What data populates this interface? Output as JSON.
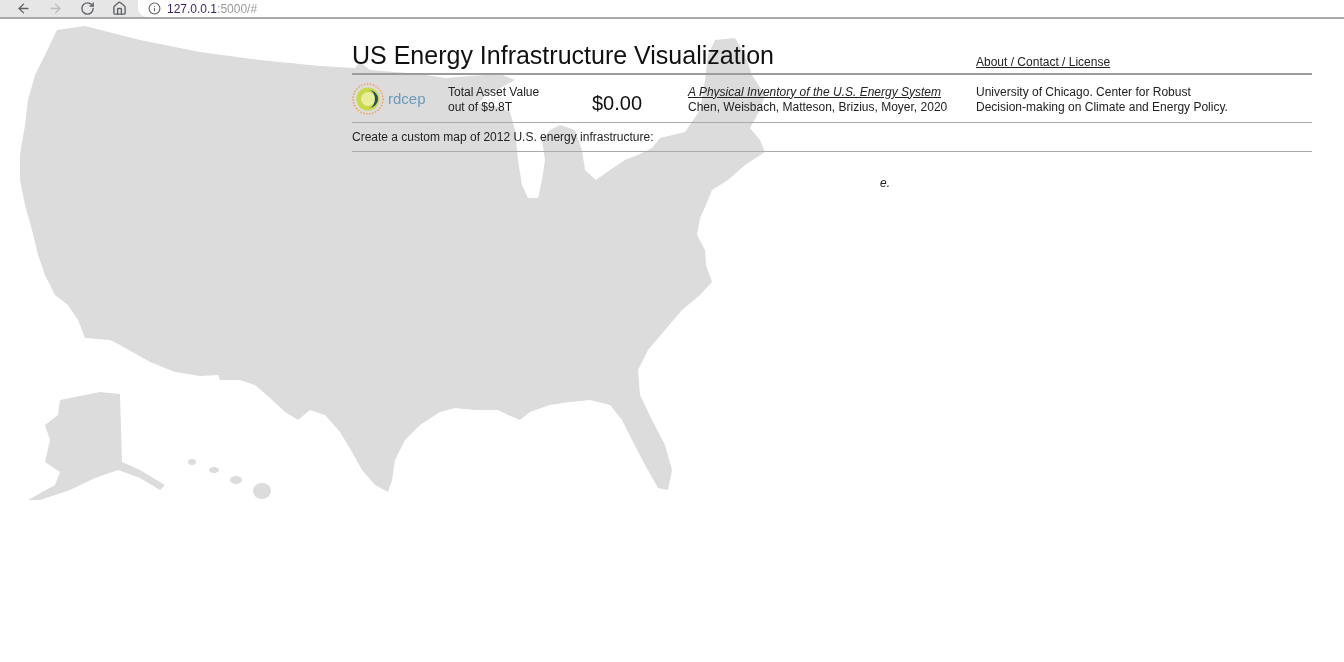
{
  "browser": {
    "nav_buttons": [
      {
        "kind": "back",
        "disabled": false
      },
      {
        "kind": "forward",
        "disabled": true
      },
      {
        "kind": "reload",
        "disabled": false
      },
      {
        "kind": "home",
        "disabled": false
      }
    ],
    "url_host": "127.0.0.1",
    "url_rest": ":5000/#"
  },
  "header": {
    "title": "US Energy Infrastructure Visualization",
    "link": "About / Contact / License"
  },
  "info": {
    "logo_text": "rdcep",
    "asset_label": "Total Asset Value",
    "asset_sub": "out of $9.8T",
    "total": "$0.00",
    "citation_title": "A Physical Inventory of the U.S. Energy System",
    "citation_authors": "Chen, Weisbach, Matteson, Brizius, Moyer, 2020",
    "affiliation": "University of Chicago. Center for Robust Decision-making on Climate and Energy Policy."
  },
  "prompt": "Create a custom map of 2012 U.S. energy infrastructure:",
  "note": "e."
}
